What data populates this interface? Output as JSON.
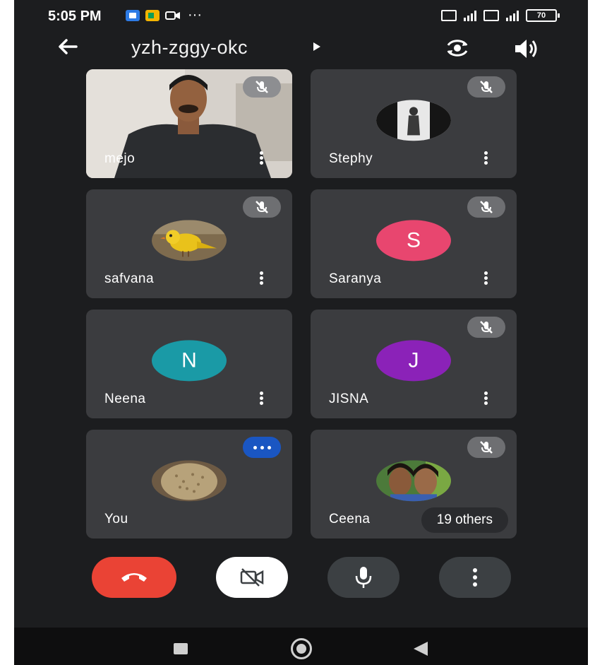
{
  "status_bar": {
    "time": "5:05 PM",
    "dots": "···",
    "battery": "70"
  },
  "header": {
    "meeting_code": "yzh-zggy-okc"
  },
  "participants": [
    {
      "name": "mejo",
      "media": "video",
      "muted": true
    },
    {
      "name": "Stephy",
      "media": "photo",
      "muted": true
    },
    {
      "name": "safvana",
      "media": "photo",
      "muted": true
    },
    {
      "name": "Saranya",
      "media": "initial",
      "initial": "S",
      "color": "#e8466f",
      "muted": true
    },
    {
      "name": "Neena",
      "media": "initial",
      "initial": "N",
      "color": "#1a9aa6",
      "muted": false
    },
    {
      "name": "JISNA",
      "media": "initial",
      "initial": "J",
      "color": "#8b22b8",
      "muted": true
    },
    {
      "name": "You",
      "media": "photo",
      "muted": false,
      "speaking": true
    },
    {
      "name": "Ceena",
      "media": "photo",
      "muted": true
    }
  ],
  "others_label": "19 others",
  "controls": {
    "end_color": "#ea4335",
    "icons": [
      "end-call-icon",
      "camera-off-icon",
      "mic-icon",
      "more-vert-icon"
    ]
  }
}
